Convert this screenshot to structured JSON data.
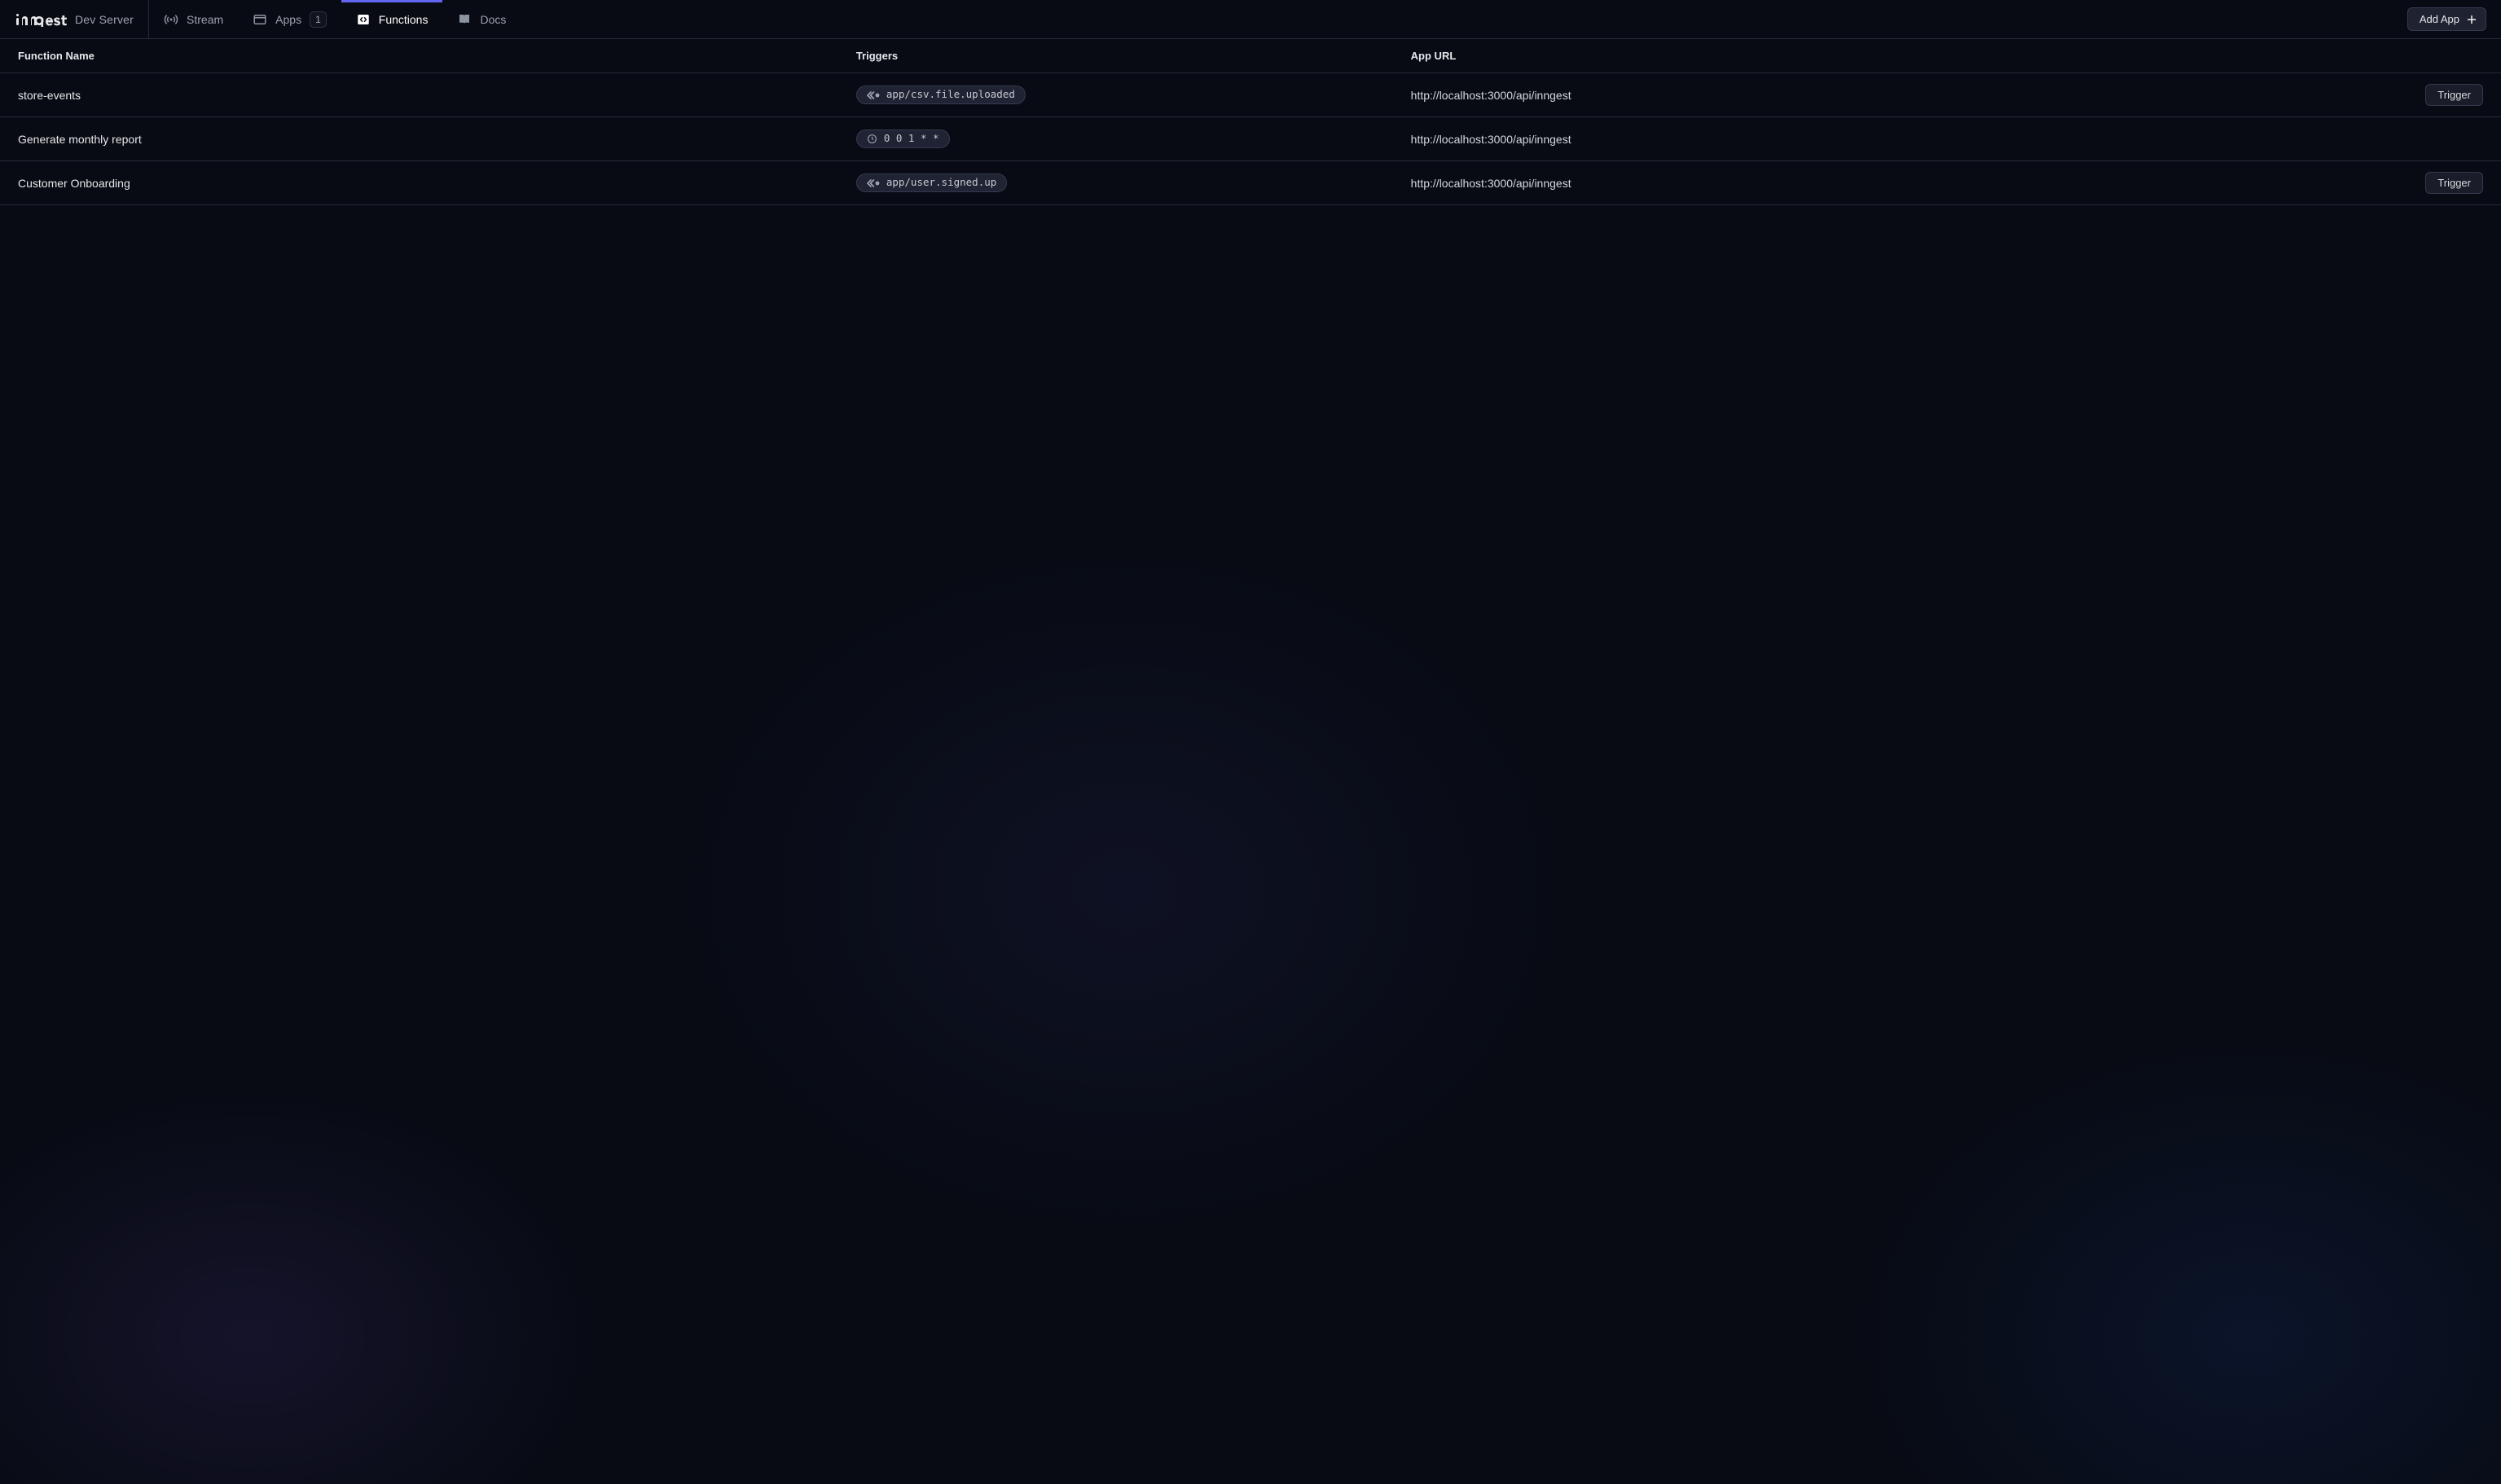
{
  "brand": {
    "product": "Dev Server"
  },
  "nav": {
    "stream": {
      "label": "Stream"
    },
    "apps": {
      "label": "Apps",
      "badge": "1"
    },
    "functions": {
      "label": "Functions"
    },
    "docs": {
      "label": "Docs"
    }
  },
  "header": {
    "add_app_label": "Add App"
  },
  "table": {
    "columns": {
      "function_name": "Function Name",
      "triggers": "Triggers",
      "app_url": "App URL"
    },
    "action_label": "Trigger",
    "rows": [
      {
        "name": "store-events",
        "trigger_type": "event",
        "trigger": "app/csv.file.uploaded",
        "url": "http://localhost:3000/api/inngest",
        "has_trigger_button": true
      },
      {
        "name": "Generate monthly report",
        "trigger_type": "cron",
        "trigger": "0 0 1 * *",
        "url": "http://localhost:3000/api/inngest",
        "has_trigger_button": false
      },
      {
        "name": "Customer Onboarding",
        "trigger_type": "event",
        "trigger": "app/user.signed.up",
        "url": "http://localhost:3000/api/inngest",
        "has_trigger_button": true
      }
    ]
  }
}
